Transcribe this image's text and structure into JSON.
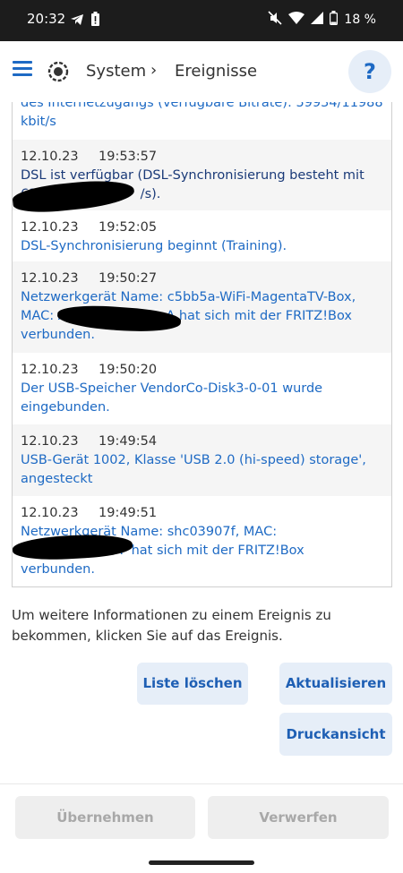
{
  "status": {
    "time": "20:32",
    "battery": "18 %",
    "icons_left": [
      "telegram-icon",
      "battery-alert-icon"
    ],
    "icons_right": [
      "mute-icon",
      "wifi-icon",
      "signal-icon",
      "battery-icon"
    ]
  },
  "header": {
    "menu_icon": "hamburger-menu-icon",
    "logo_icon": "fritz-logo-icon",
    "breadcrumb_system": "System",
    "breadcrumb_sep": "›",
    "breadcrumb_events": "Ereignisse",
    "help_label": "?"
  },
  "events": {
    "partial_top": {
      "line1": "des Internetzugangs (verfügbare Bitrate): 59934/11988",
      "line2": "kbit/s"
    },
    "items": [
      {
        "date": "12.10.23",
        "time": "19:53:57",
        "line1": "DSL ist verfügbar (DSL-Synchronisierung besteht mit",
        "line2": "63                         /s)."
      },
      {
        "date": "12.10.23",
        "time": "19:52:05",
        "line1": "DSL-Synchronisierung beginnt (Training)."
      },
      {
        "date": "12.10.23",
        "time": "19:50:27",
        "line1": "Netzwerkgerät Name: c5bb5a-WiFi-MagentaTV-Box,",
        "line2": "MAC: A                        A hat sich mit der FRITZ!Box",
        "line3": "verbunden."
      },
      {
        "date": "12.10.23",
        "time": "19:50:20",
        "line1": "Der USB-Speicher VendorCo-Disk3-0-01 wurde",
        "line2": "eingebunden."
      },
      {
        "date": "12.10.23",
        "time": "19:49:54",
        "line1": "USB-Gerät 1002, Klasse 'USB 2.0 (hi-speed) storage',",
        "line2": "angesteckt"
      },
      {
        "date": "12.10.23",
        "time": "19:49:51",
        "line1": "Netzwerkgerät Name: shc03907f, MAC:",
        "line2": "                        F hat sich mit der FRITZ!Box",
        "line3": "verbunden."
      }
    ]
  },
  "info_text": "Um weitere Informationen zu einem Ereignis zu bekommen, klicken Sie auf das Ereignis.",
  "buttons": {
    "clear": "Liste löschen",
    "refresh": "Aktualisieren",
    "print": "Druckansicht"
  },
  "footer": {
    "apply": "Übernehmen",
    "discard": "Verwerfen"
  },
  "colors": {
    "accent": "#1e6ac4",
    "button_bg": "#e6eef8",
    "statusbar": "#1c1c1c"
  }
}
